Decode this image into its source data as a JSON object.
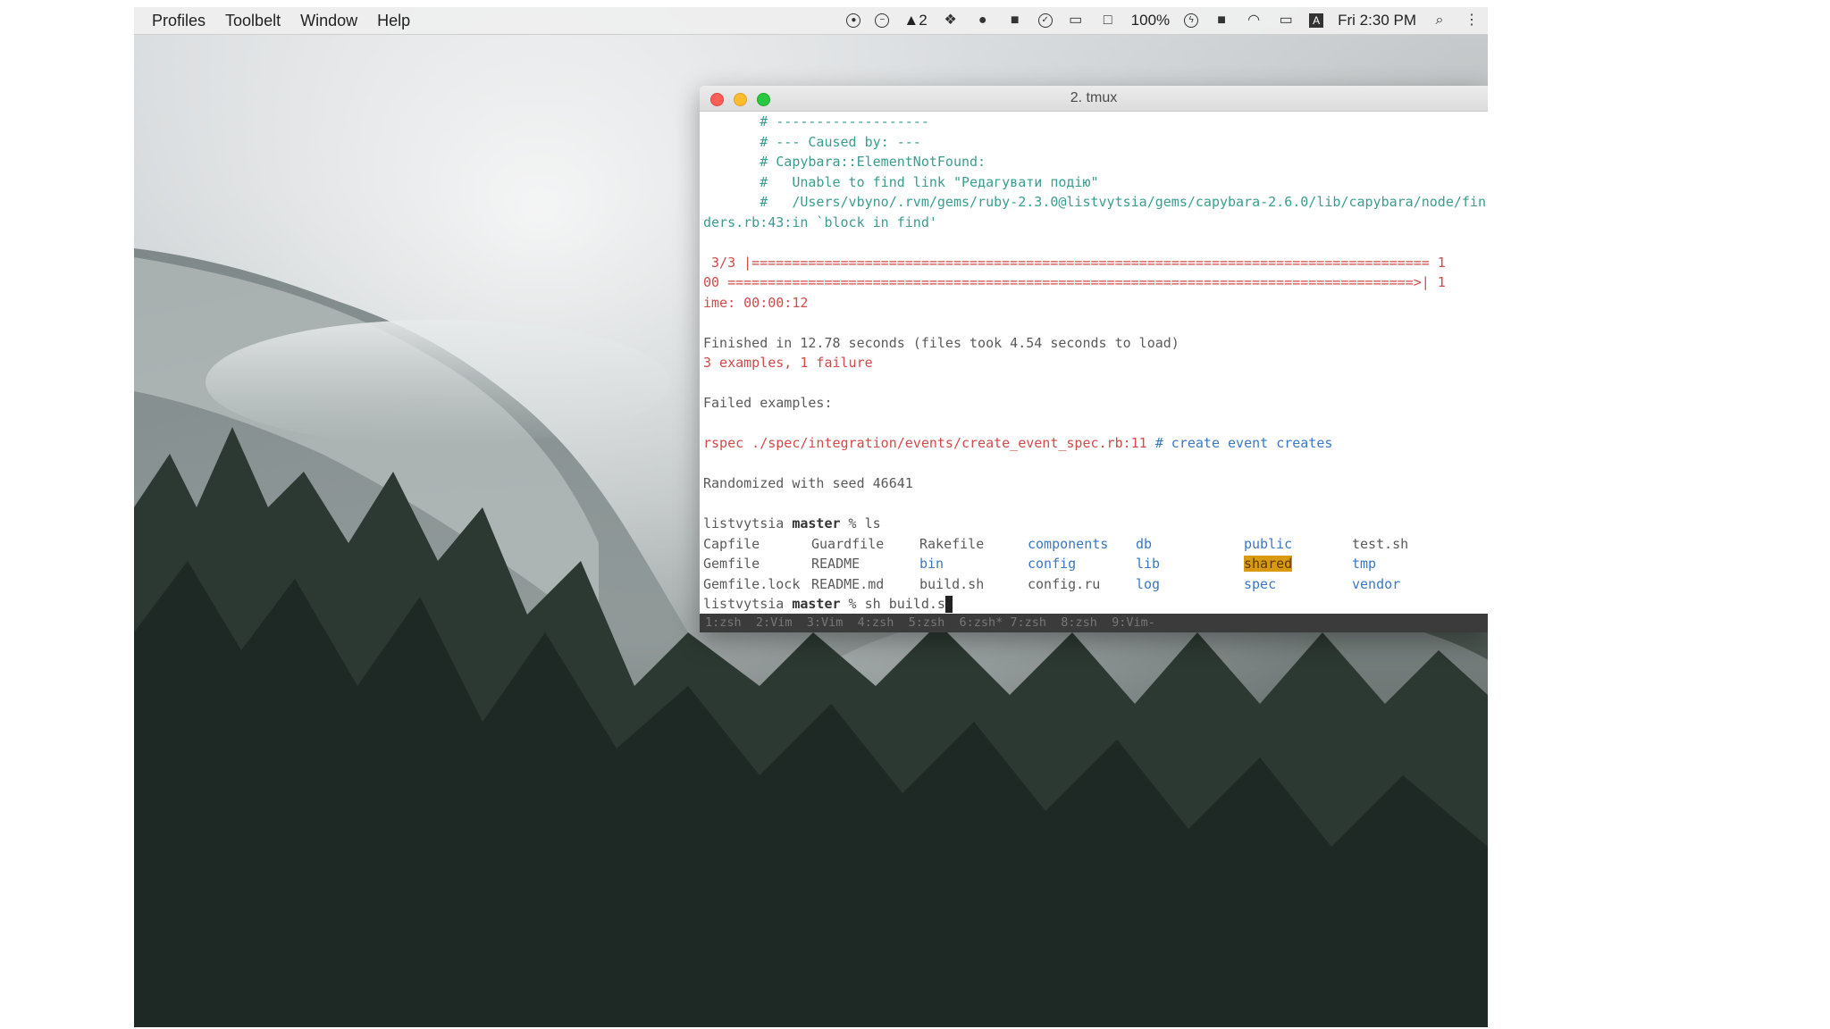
{
  "menubar": {
    "items": [
      "Profiles",
      "Toolbelt",
      "Window",
      "Help"
    ],
    "status": {
      "icon_a_label": "2",
      "battery_percent": "100%",
      "keyboard_label": "A",
      "clock": "Fri 2:30 PM"
    }
  },
  "window": {
    "title": "2. tmux"
  },
  "terminal": {
    "lines": [
      "       # -------------------",
      "       # --- Caused by: ---",
      "       # Capybara::ElementNotFound:",
      "       #   Unable to find link \"Редагувати подію\"",
      "       #   /Users/vbyno/.rvm/gems/ruby-2.3.0@listvytsia/gems/capybara-2.6.0/lib/capybara/node/fin",
      "ders.rb:43:in `block in find'",
      "",
      " 3/3 |==================================================================================== 1",
      "00 =====================================================================================>| 1",
      "ime: 00:00:12",
      "",
      "Finished in 12.78 seconds (files took 4.54 seconds to load)",
      "3 examples, 1 failure",
      "",
      "Failed examples:",
      "",
      "",
      "",
      "Randomized with seed 46641",
      ""
    ],
    "rspec_cmd": "rspec ./spec/integration/events/create_event_spec.rb:11",
    "rspec_comment": " # create event creates",
    "prompt_user": "listvytsia",
    "prompt_branch": "master",
    "prompt_symbol": " % ",
    "ls_cmd": "ls",
    "ls_rows": [
      [
        "Capfile",
        "Guardfile",
        "Rakefile",
        "components",
        "db",
        "public",
        "test.sh"
      ],
      [
        "Gemfile",
        "README",
        "bin",
        "config",
        "lib",
        "shared",
        "tmp"
      ],
      [
        "Gemfile.lock",
        "README.md",
        "build.sh",
        "config.ru",
        "log",
        "spec",
        "vendor"
      ]
    ],
    "current_cmd": "sh build.s"
  },
  "tmux_bar": "1:zsh  2:Vim  3:Vim  4:zsh  5:zsh  6:zsh* 7:zsh  8:zsh  9:Vim-",
  "colors": {
    "comment": "#3a9d8f",
    "error": "#d24a4a",
    "directory": "#3a78c4",
    "highlight": "#d99a10"
  }
}
